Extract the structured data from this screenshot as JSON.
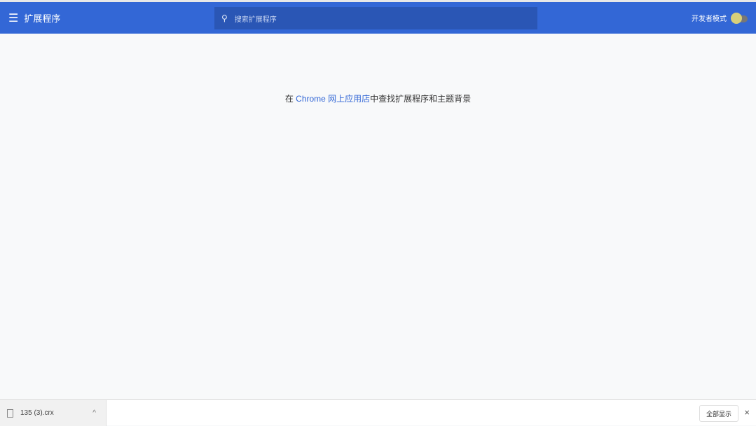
{
  "header": {
    "title": "扩展程序",
    "search_placeholder": "搜索扩展程序",
    "dev_mode_label": "开发者模式",
    "dev_mode_on": false
  },
  "main": {
    "prefix": "在 ",
    "link": "Chrome 网上应用店",
    "suffix": "中查找扩展程序和主题背景"
  },
  "downloads": {
    "file_name": "135 (3).crx",
    "show_all": "全部显示",
    "close": "×",
    "caret": "^"
  }
}
